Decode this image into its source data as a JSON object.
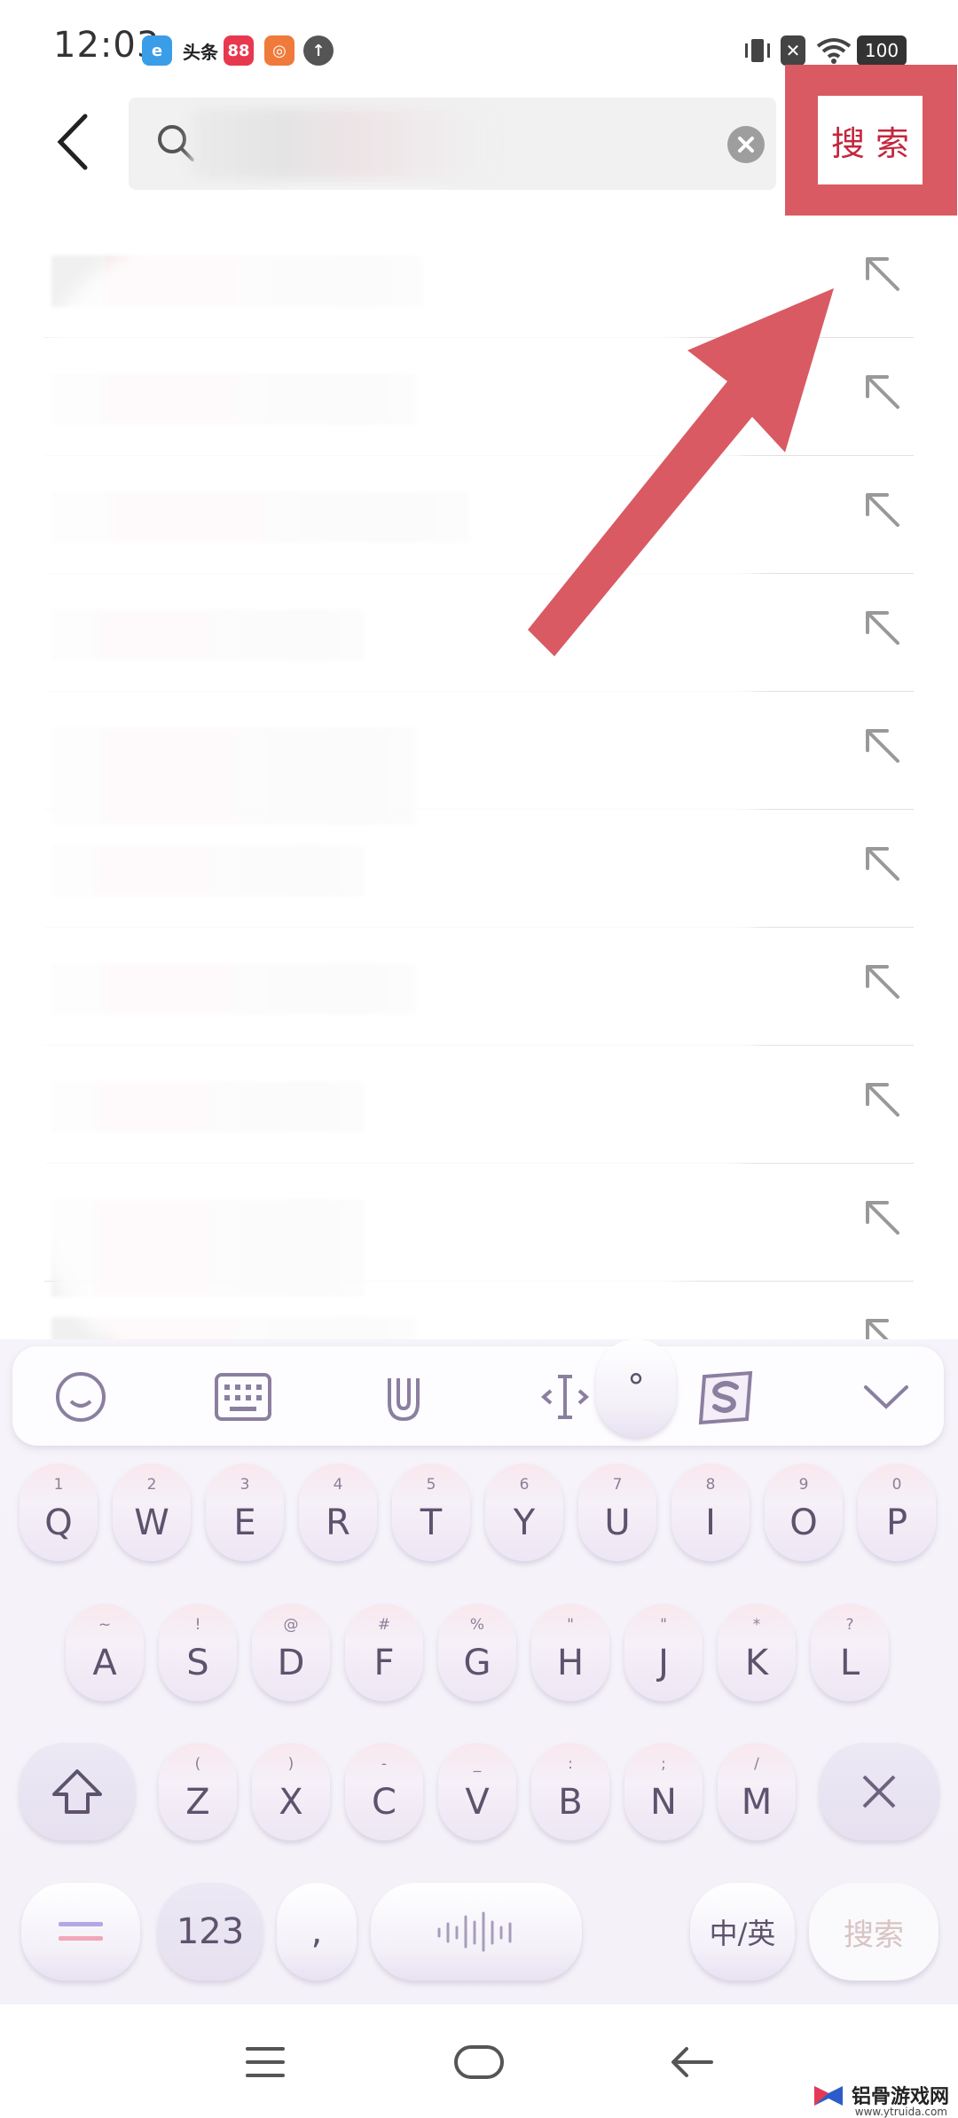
{
  "status_bar": {
    "time": "12:03",
    "notifications": [
      "e",
      "头条",
      "88",
      "◎",
      "↑"
    ],
    "battery": "100"
  },
  "search": {
    "query": "",
    "placeholder": "",
    "search_button": "搜 索"
  },
  "suggestions": [
    {
      "text": ""
    },
    {
      "text": ""
    },
    {
      "text": ""
    },
    {
      "text": ""
    },
    {
      "text": ""
    },
    {
      "text": ""
    },
    {
      "text": ""
    },
    {
      "text": ""
    },
    {
      "text": ""
    },
    {
      "text": ""
    }
  ],
  "keyboard": {
    "row1": [
      {
        "main": "Q",
        "sub": "1"
      },
      {
        "main": "W",
        "sub": "2"
      },
      {
        "main": "E",
        "sub": "3"
      },
      {
        "main": "R",
        "sub": "4"
      },
      {
        "main": "T",
        "sub": "5"
      },
      {
        "main": "Y",
        "sub": "6"
      },
      {
        "main": "U",
        "sub": "7"
      },
      {
        "main": "I",
        "sub": "8"
      },
      {
        "main": "O",
        "sub": "9"
      },
      {
        "main": "P",
        "sub": "0"
      }
    ],
    "row2": [
      {
        "main": "A",
        "sub": "~"
      },
      {
        "main": "S",
        "sub": "!"
      },
      {
        "main": "D",
        "sub": "@"
      },
      {
        "main": "F",
        "sub": "#"
      },
      {
        "main": "G",
        "sub": "%"
      },
      {
        "main": "H",
        "sub": "\""
      },
      {
        "main": "J",
        "sub": "\""
      },
      {
        "main": "K",
        "sub": "*"
      },
      {
        "main": "L",
        "sub": "?"
      }
    ],
    "row3": [
      {
        "main": "Z",
        "sub": "("
      },
      {
        "main": "X",
        "sub": ")"
      },
      {
        "main": "C",
        "sub": "-"
      },
      {
        "main": "V",
        "sub": "_"
      },
      {
        "main": "B",
        "sub": ":"
      },
      {
        "main": "N",
        "sub": ";"
      },
      {
        "main": "M",
        "sub": "/"
      }
    ],
    "num_key": "123",
    "comma_key": ",",
    "period_key": "°",
    "lang_key": "中/英",
    "search_key": "搜索"
  },
  "watermark": {
    "text": "铝骨游戏网",
    "url": "www.ytruida.com"
  },
  "colors": {
    "annotation": "#d95a63",
    "search_text": "#c4263e"
  }
}
